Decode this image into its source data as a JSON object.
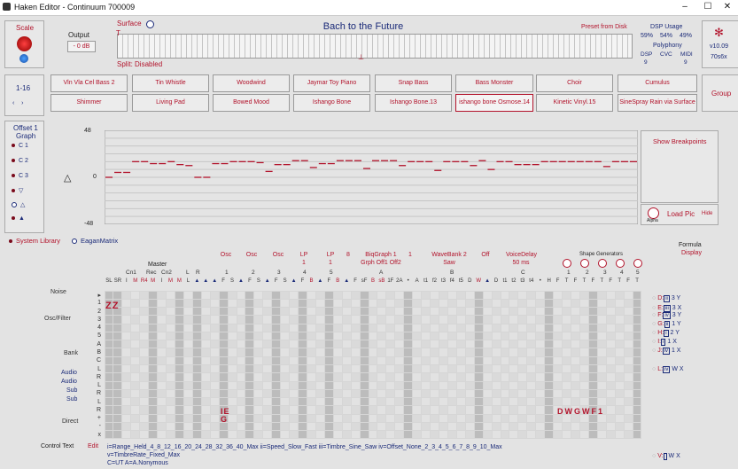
{
  "window": {
    "title": "Haken Editor - Continuum 700009"
  },
  "left": {
    "scale_label": "Scale",
    "channel_label": "1-16",
    "offset_label": "Offset 1",
    "graph_label": "Graph",
    "graph_items": [
      "C 1",
      "C 2",
      "C 3",
      "▽",
      "△",
      "▲"
    ]
  },
  "output": {
    "label": "Output",
    "value": "- 0 dB"
  },
  "surface": {
    "label": "Surface",
    "split": "Split: Disabled",
    "title": "Bach to the Future",
    "preset_from": "Preset from Disk"
  },
  "dsp": {
    "label": "DSP Usage",
    "values": [
      "59%",
      "54%",
      "49%"
    ],
    "poly_label": "Polyphony",
    "poly_cols": [
      "DSP",
      "CVC",
      "MIDI"
    ],
    "poly_vals": [
      "9",
      "",
      "9"
    ]
  },
  "version": {
    "v1": "v10.09",
    "v2": "70s6x"
  },
  "group_label": "Group",
  "presets_row1": [
    "Vln Vla Cel Bass 2",
    "Tin Whistle",
    "Woodwind",
    "Jaymar Toy Piano",
    "Snap Bass",
    "Bass Monster",
    "Choir",
    "Cumulus"
  ],
  "presets_row2": [
    "Shimmer",
    "Living Pad",
    "Bowed Mood",
    "Ishango Bone",
    "Ishango Bone.13",
    "ishango bone Osmose.14",
    "Kinetic Vinyl.15",
    "SineSpray Rain via Surface"
  ],
  "graph": {
    "ytop": "48",
    "ymid": "0",
    "ybot": "-48",
    "show_bp": "Show Breakpoints",
    "load_pic": "Load Pic",
    "hide": "Hide",
    "alpha": "Alpha",
    "levels": [
      0,
      5,
      5,
      16,
      16,
      14,
      14,
      16,
      13,
      12,
      0,
      0,
      14,
      14,
      16,
      16,
      16,
      15,
      6,
      13,
      13,
      17,
      17,
      10,
      14,
      14,
      17,
      17,
      17,
      9,
      17,
      17,
      17,
      12,
      16,
      16,
      16,
      7,
      16,
      16,
      16,
      12,
      17,
      8,
      16,
      16,
      13,
      13,
      13,
      16,
      16,
      16,
      16,
      16,
      16,
      16,
      11,
      16,
      16,
      16
    ]
  },
  "library": {
    "system": "System Library",
    "eagan": "EaganMatrix"
  },
  "matrix": {
    "master": "Master",
    "master_sub": [
      "Cn1",
      "Rec",
      "Cn2",
      "L",
      "R"
    ],
    "groups": [
      {
        "t": "Osc",
        "s": ""
      },
      {
        "t": "Osc",
        "s": ""
      },
      {
        "t": "Osc",
        "s": ""
      },
      {
        "t": "LP",
        "s": "1"
      },
      {
        "t": "LP",
        "s": "1"
      },
      {
        "t": "8",
        "s": ""
      },
      {
        "t": "BiqGraph 1",
        "s": "Grph Off1 Off2"
      },
      {
        "t": "1",
        "s": ""
      },
      {
        "t": "WaveBank 2",
        "s": "Saw"
      },
      {
        "t": "Off",
        "s": ""
      },
      {
        "t": "VoiceDelay",
        "s": "50 ms"
      }
    ],
    "shape_gen": "Shape Generators",
    "formula": "Formula",
    "display": "Display",
    "row_labels": [
      "Noise",
      "Osc/Filter",
      "Bank",
      "Audio",
      "Audio",
      "Sub",
      "Sub",
      "Direct"
    ],
    "row_codes": [
      "▸",
      "1",
      "2",
      "3",
      "4",
      "5",
      "A",
      "B",
      "C",
      "L",
      "R",
      "L",
      "R",
      "L",
      "R",
      "+",
      "-",
      "x"
    ],
    "col_codes": [
      "SL",
      "SR",
      "I",
      "M",
      "R4",
      "M",
      "I",
      "M",
      "M",
      "L",
      "▲",
      "▲",
      "▲",
      "F",
      "S",
      "▲",
      "F",
      "S",
      "▲",
      "F",
      "S",
      "▲",
      "F",
      "B",
      "▲",
      "F",
      "B",
      "▲",
      "F",
      "sF",
      "B",
      "sB",
      "1F",
      "2A",
      "•",
      "A",
      "t1",
      "f2",
      "t3",
      "f4",
      "t5",
      "D",
      "W",
      "▲",
      "D",
      "t1",
      "t2",
      "t3",
      "t4",
      "•",
      "H",
      "F",
      "T",
      "F",
      "T",
      "F",
      "T",
      "F",
      "T",
      "F",
      "T"
    ],
    "col_groups": [
      "1",
      "2",
      "3",
      "4",
      "5",
      "A",
      "B",
      "C",
      "1",
      "2",
      "3",
      "4",
      "5"
    ],
    "marks": {
      "zz": "ZZ",
      "ie": "IE",
      "g": "G",
      "dwg": "DWGWF1"
    },
    "formulas": [
      {
        "l": "D:",
        "i": "ii",
        "a": "3",
        "b": "Y"
      },
      {
        "l": "E:",
        "i": "iii",
        "a": "3",
        "b": "X"
      },
      {
        "l": "F:",
        "i": "iv",
        "a": "3",
        "b": "Y"
      },
      {
        "l": "G:",
        "i": "ii",
        "a": "1",
        "b": "Y"
      },
      {
        "l": "H:",
        "i": "i",
        "a": "2",
        "b": "Y"
      },
      {
        "l": "I:",
        "i": "i",
        "a": "1",
        "b": "X"
      },
      {
        "l": "J:",
        "i": "iv",
        "a": "1",
        "b": "X"
      },
      {
        "l": "L:",
        "i": "iv",
        "a": "W",
        "b": "X"
      },
      {
        "l": "V:",
        "i": "",
        "a": "W",
        "b": "X"
      }
    ]
  },
  "control": {
    "label": "Control Text",
    "edit": "Edit",
    "line1": "i=Range_Held_4_8_12_16_20_24_28_32_36_40_Max ii=Speed_Slow_Fast iii=Timbre_Sine_Saw iv=Offset_None_2_3_4_5_6_7_8_9_10_Max",
    "line2": "v=TimbreRate_Fixed_Max",
    "line3": "C=UT A=A.Nonymous"
  },
  "colors": {
    "accent": "#b2132b",
    "navy": "#1a2a78",
    "bg": "#e3e3e3"
  }
}
